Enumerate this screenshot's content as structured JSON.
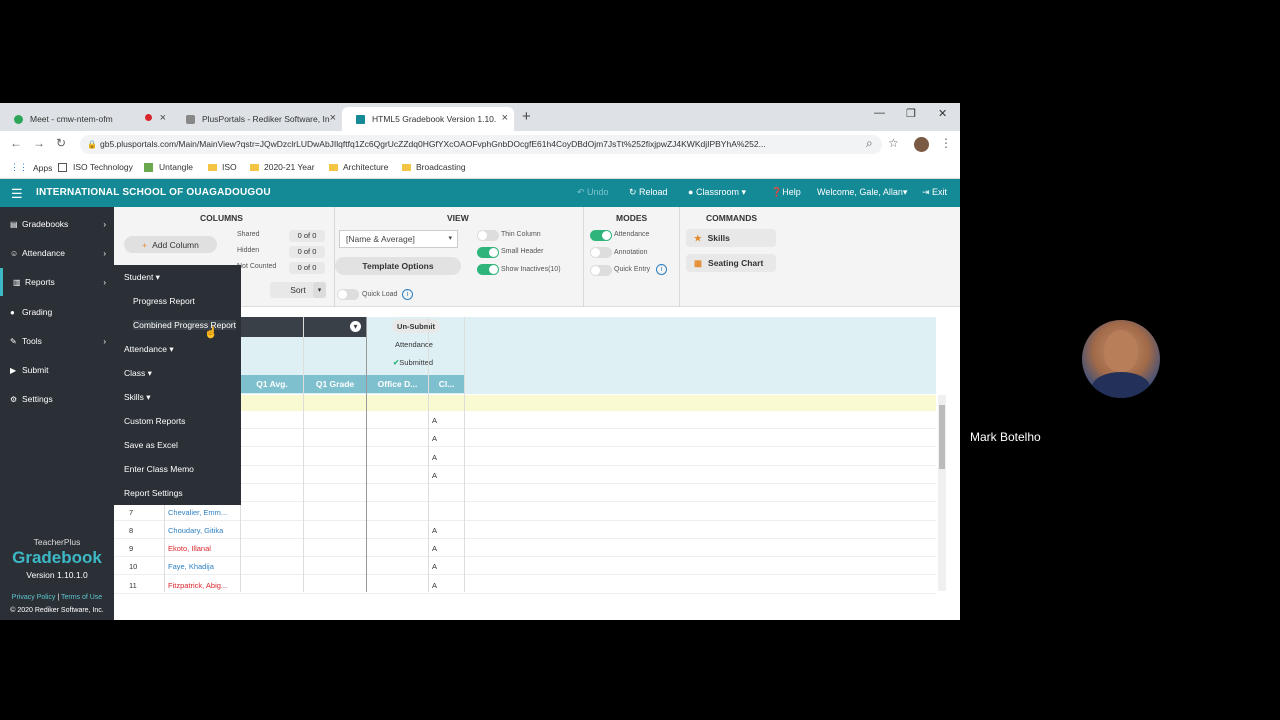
{
  "browser": {
    "tabs": [
      {
        "title": "Meet - cmw-ntem-ofm",
        "active": false
      },
      {
        "title": "PlusPortals - Rediker Software, In",
        "active": false
      },
      {
        "title": "HTML5 Gradebook Version 1.10.",
        "active": true
      }
    ],
    "url": "gb5.plusportals.com/Main/MainView?qstr=JQwDzclrLUDwAbJIlqftfq1Zc6QgrUcZZdq0HGfYXcOAOFvphGnbDOcgfE61h4CoyDBdOjm7JsTt%252fixjpwZJ4KWKdjIPBYhA%252...",
    "bookmarks": [
      "Apps",
      "ISO Technology",
      "Untangle",
      "ISO",
      "2020-21 Year",
      "Architecture",
      "Broadcasting"
    ]
  },
  "app": {
    "school": "INTERNATIONAL SCHOOL OF OUAGADOUGOU",
    "header_actions": {
      "undo": "Undo",
      "reload": "Reload",
      "classroom": "Classroom",
      "help": "Help",
      "welcome": "Welcome, Gale, Allan",
      "exit": "Exit"
    },
    "accent": "#138a96"
  },
  "sidebar": {
    "items": [
      {
        "label": "Gradebooks"
      },
      {
        "label": "Attendance"
      },
      {
        "label": "Reports"
      },
      {
        "label": "Grading"
      },
      {
        "label": "Tools"
      },
      {
        "label": "Submit"
      },
      {
        "label": "Settings"
      }
    ],
    "brand_top": "TeacherPlus",
    "brand": "Gradebook",
    "version": "Version 1.10.1.0",
    "privacy": "Privacy Policy",
    "terms": "Terms of Use",
    "copyright": "© 2020 Rediker Software, Inc."
  },
  "toolbar": {
    "columns_title": "COLUMNS",
    "add_column": "Add Column",
    "shared_label": "Shared",
    "shared_value": "0 of 0",
    "hidden_label": "Hidden",
    "hidden_value": "0 of 0",
    "not_counted_label": "Not Counted",
    "not_counted_value": "0 of 0",
    "sort": "Sort",
    "view_title": "VIEW",
    "view_select": "[Name & Average]",
    "template_options": "Template Options",
    "thin_column": "Thin Column",
    "small_header": "Small Header",
    "show_inactives": "Show Inactives(10)",
    "quick_load": "Quick Load",
    "modes_title": "MODES",
    "attendance_mode": "Attendance",
    "annotation_mode": "Annotation",
    "quick_entry_mode": "Quick Entry",
    "commands_title": "COMMANDS",
    "skills": "Skills",
    "seating_chart": "Seating Chart"
  },
  "reports_menu": {
    "student": "Student",
    "progress_report": "Progress Report",
    "combined_progress_report": "Combined Progress Report",
    "attendance": "Attendance",
    "class": "Class",
    "skills": "Skills",
    "custom_reports": "Custom Reports",
    "save_as_excel": "Save as Excel",
    "enter_class_memo": "Enter Class Memo",
    "report_settings": "Report Settings"
  },
  "grid": {
    "unsubmit": "Un-Submit",
    "attendance": "Attendance",
    "submitted": "Submitted",
    "columns": [
      "Q1 Avg.",
      "Q1 Grade",
      "Office D...",
      "Cl..."
    ],
    "rows": [
      {
        "num": "",
        "name": "",
        "att": "A"
      },
      {
        "num": "",
        "name": "",
        "att": "A"
      },
      {
        "num": "",
        "name": "",
        "att": "A"
      },
      {
        "num": "",
        "name": "",
        "att": "A"
      },
      {
        "num": "",
        "name": "",
        "att": ""
      },
      {
        "num": "7",
        "name": "Chevalier, Emm...",
        "att": "",
        "color": "#2d7fc1"
      },
      {
        "num": "8",
        "name": "Choudary, Gitika",
        "att": "A",
        "color": "#2d7fc1"
      },
      {
        "num": "9",
        "name": "Ekoto, Illanal",
        "att": "A",
        "color": "#d8262b"
      },
      {
        "num": "10",
        "name": "Faye, Khadija",
        "att": "A",
        "color": "#2d7fc1"
      },
      {
        "num": "11",
        "name": "Fitzpatrick, Abig...",
        "att": "A",
        "color": "#d8262b"
      }
    ]
  },
  "video": {
    "participant": "Mark Botelho"
  }
}
